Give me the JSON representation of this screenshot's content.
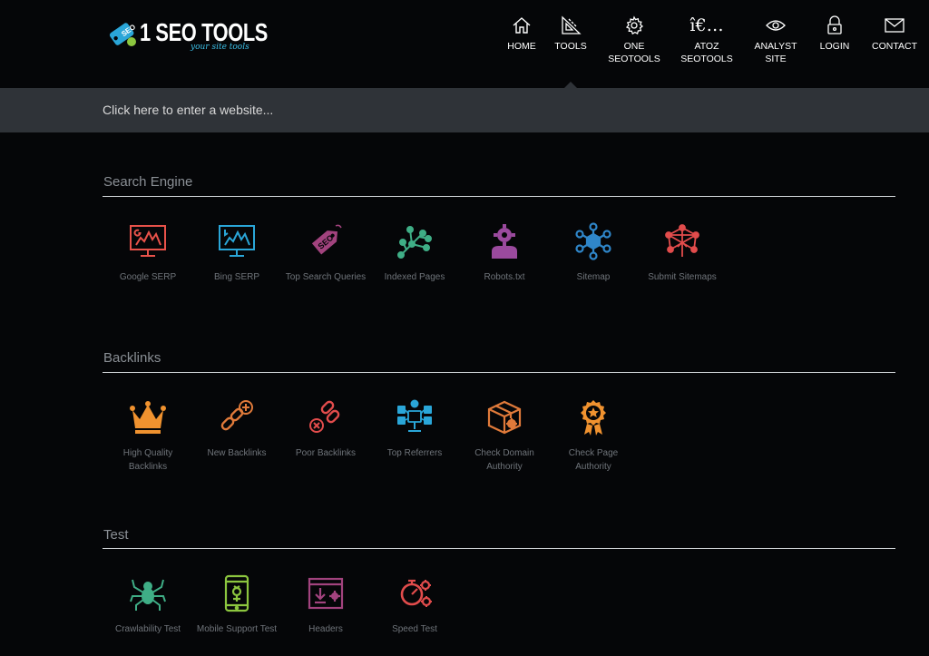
{
  "brand": {
    "logo_text": "1 SEO TOOLS",
    "logo_badge": "SEO",
    "logo_sub": "your site tools"
  },
  "nav": [
    {
      "label": "HOME",
      "icon": "home-icon"
    },
    {
      "label": "TOOLS",
      "icon": "tools-icon"
    },
    {
      "label": "ONE\nSEOTOOLS",
      "icon": "gear-icon"
    },
    {
      "label": "ATOZ\nSEOTOOLS",
      "icon": "ie-glyph",
      "glyph": "î€…"
    },
    {
      "label": "ANALYST\nSITE",
      "icon": "eye-icon"
    },
    {
      "label": "LOGIN",
      "icon": "lock-icon"
    },
    {
      "label": "CONTACT",
      "icon": "envelope-icon"
    }
  ],
  "search": {
    "placeholder": "Click here to enter a website..."
  },
  "sections": [
    {
      "title": "Search Engine",
      "tools": [
        {
          "label": "Google SERP",
          "icon": "google-serp-icon",
          "color": "#e8524a"
        },
        {
          "label": "Bing SERP",
          "icon": "bing-serp-icon",
          "color": "#2aa6d8"
        },
        {
          "label": "Top Search Queries",
          "icon": "seo-tag-icon",
          "color": "#a2437e"
        },
        {
          "label": "Indexed Pages",
          "icon": "network-tree-icon",
          "color": "#3fae86"
        },
        {
          "label": "Robots.txt",
          "icon": "robot-user-icon",
          "color": "#9b4a9e"
        },
        {
          "label": "Sitemap",
          "icon": "sitemap-hub-icon",
          "color": "#2f86c9"
        },
        {
          "label": "Submit Sitemaps",
          "icon": "submit-network-icon",
          "color": "#e24c4c"
        }
      ]
    },
    {
      "title": "Backlinks",
      "tools": [
        {
          "label": "High Quality Backlinks",
          "icon": "crown-icon",
          "color": "#f0922f"
        },
        {
          "label": "New Backlinks",
          "icon": "chain-plus-icon",
          "color": "#e07a3a"
        },
        {
          "label": "Poor Backlinks",
          "icon": "chain-x-icon",
          "color": "#e24c4c"
        },
        {
          "label": "Top Referrers",
          "icon": "social-referrers-icon",
          "color": "#2aa6d8"
        },
        {
          "label": "Check Domain Authority",
          "icon": "box-gear-icon",
          "color": "#e07a3a"
        },
        {
          "label": "Check Page Authority",
          "icon": "award-badge-icon",
          "color": "#f0922f"
        }
      ]
    },
    {
      "title": "Test",
      "tools": [
        {
          "label": "Crawlability Test",
          "icon": "spider-icon",
          "color": "#3fae86"
        },
        {
          "label": "Mobile Support Test",
          "icon": "mobile-icon",
          "color": "#8cc63f"
        },
        {
          "label": "Headers",
          "icon": "browser-download-icon",
          "color": "#a2437e"
        },
        {
          "label": "Speed Test",
          "icon": "speed-gears-icon",
          "color": "#e24c4c"
        }
      ]
    }
  ]
}
